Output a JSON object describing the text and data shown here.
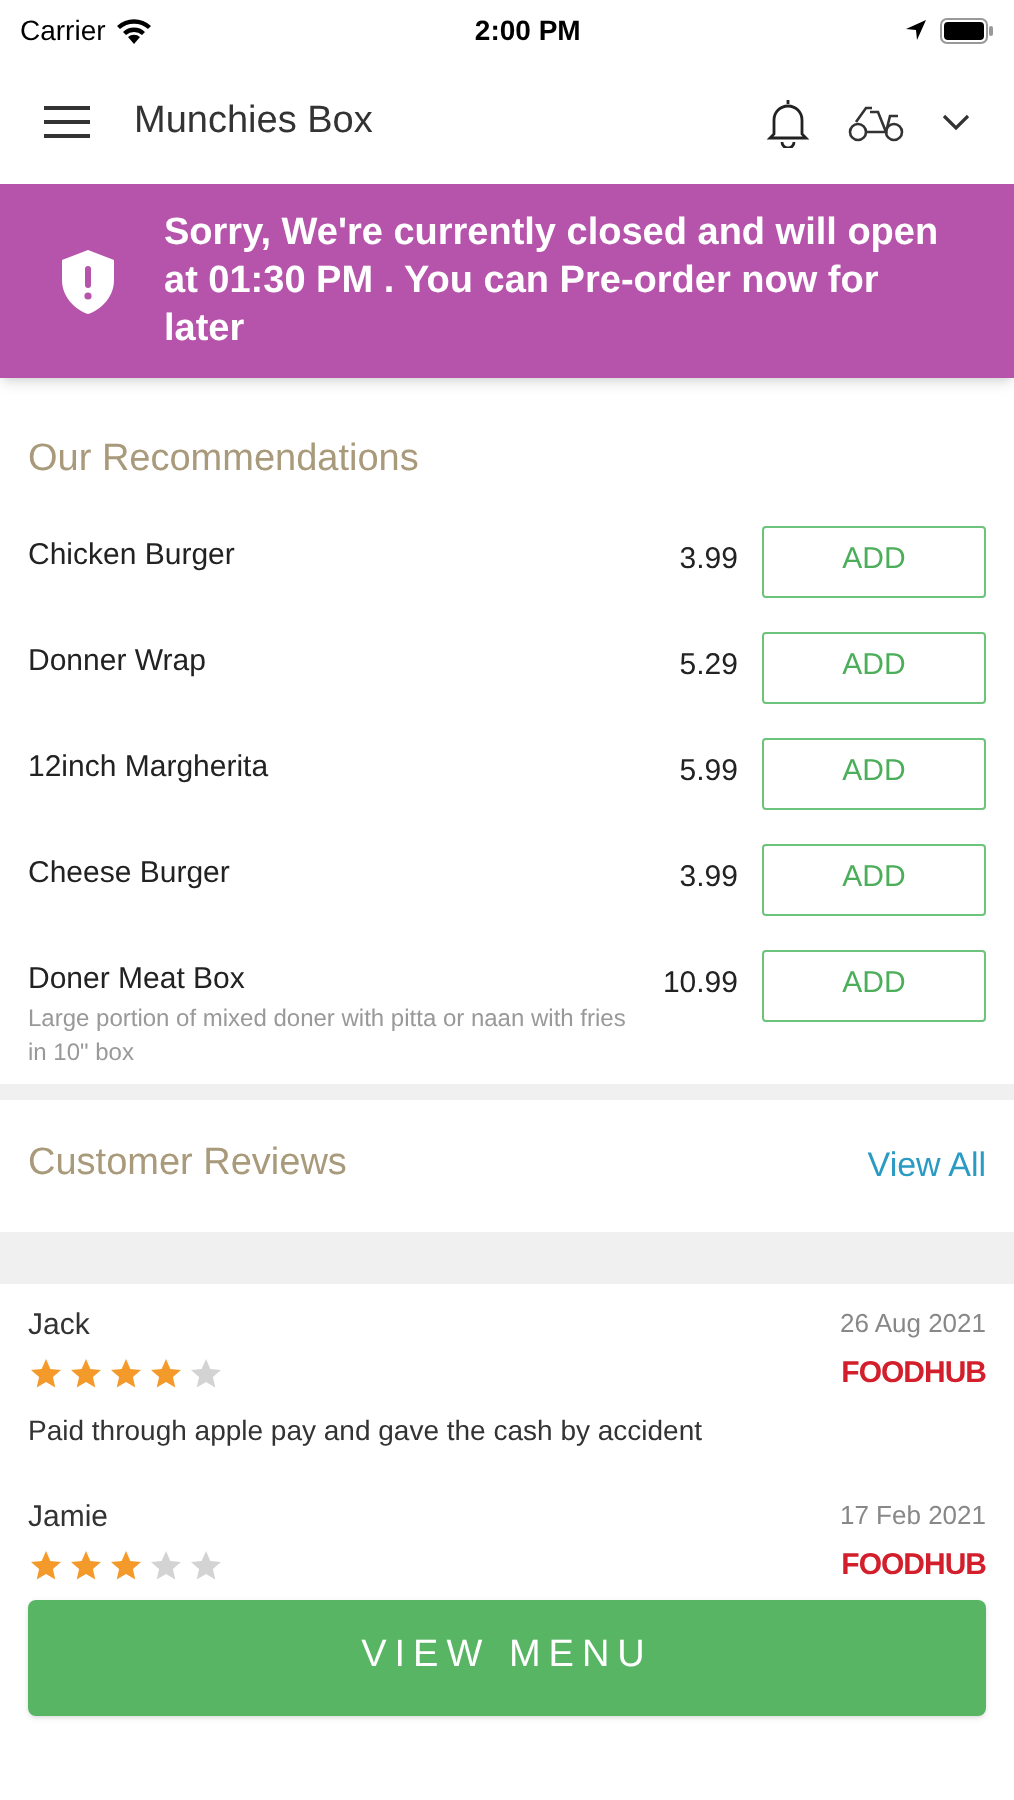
{
  "status_bar": {
    "carrier": "Carrier",
    "time": "2:00 PM"
  },
  "header": {
    "title": "Munchies Box"
  },
  "banner": {
    "message": "Sorry, We're currently closed and will open at 01:30 PM . You can Pre-order now for later"
  },
  "recommendations": {
    "title": "Our Recommendations",
    "items": [
      {
        "name": "Chicken Burger",
        "price": "3.99",
        "button": "ADD"
      },
      {
        "name": "Donner Wrap",
        "price": "5.29",
        "button": "ADD"
      },
      {
        "name": "12inch Margherita",
        "price": "5.99",
        "button": "ADD"
      },
      {
        "name": "Cheese Burger",
        "price": "3.99",
        "button": "ADD"
      },
      {
        "name": "Doner Meat Box",
        "description": "Large portion of mixed doner with pitta or naan with fries in 10\" box",
        "price": "10.99",
        "button": "ADD"
      }
    ]
  },
  "reviews": {
    "title": "Customer Reviews",
    "view_all": "View All",
    "items": [
      {
        "name": "Jack",
        "date": "26 Aug 2021",
        "stars": 4,
        "source": "FOODHUB",
        "text": "Paid through apple pay and gave the cash by accident"
      },
      {
        "name": "Jamie",
        "date": "17 Feb 2021",
        "stars": 3,
        "source": "FOODHUB"
      }
    ]
  },
  "footer_button": "VIEW MENU"
}
